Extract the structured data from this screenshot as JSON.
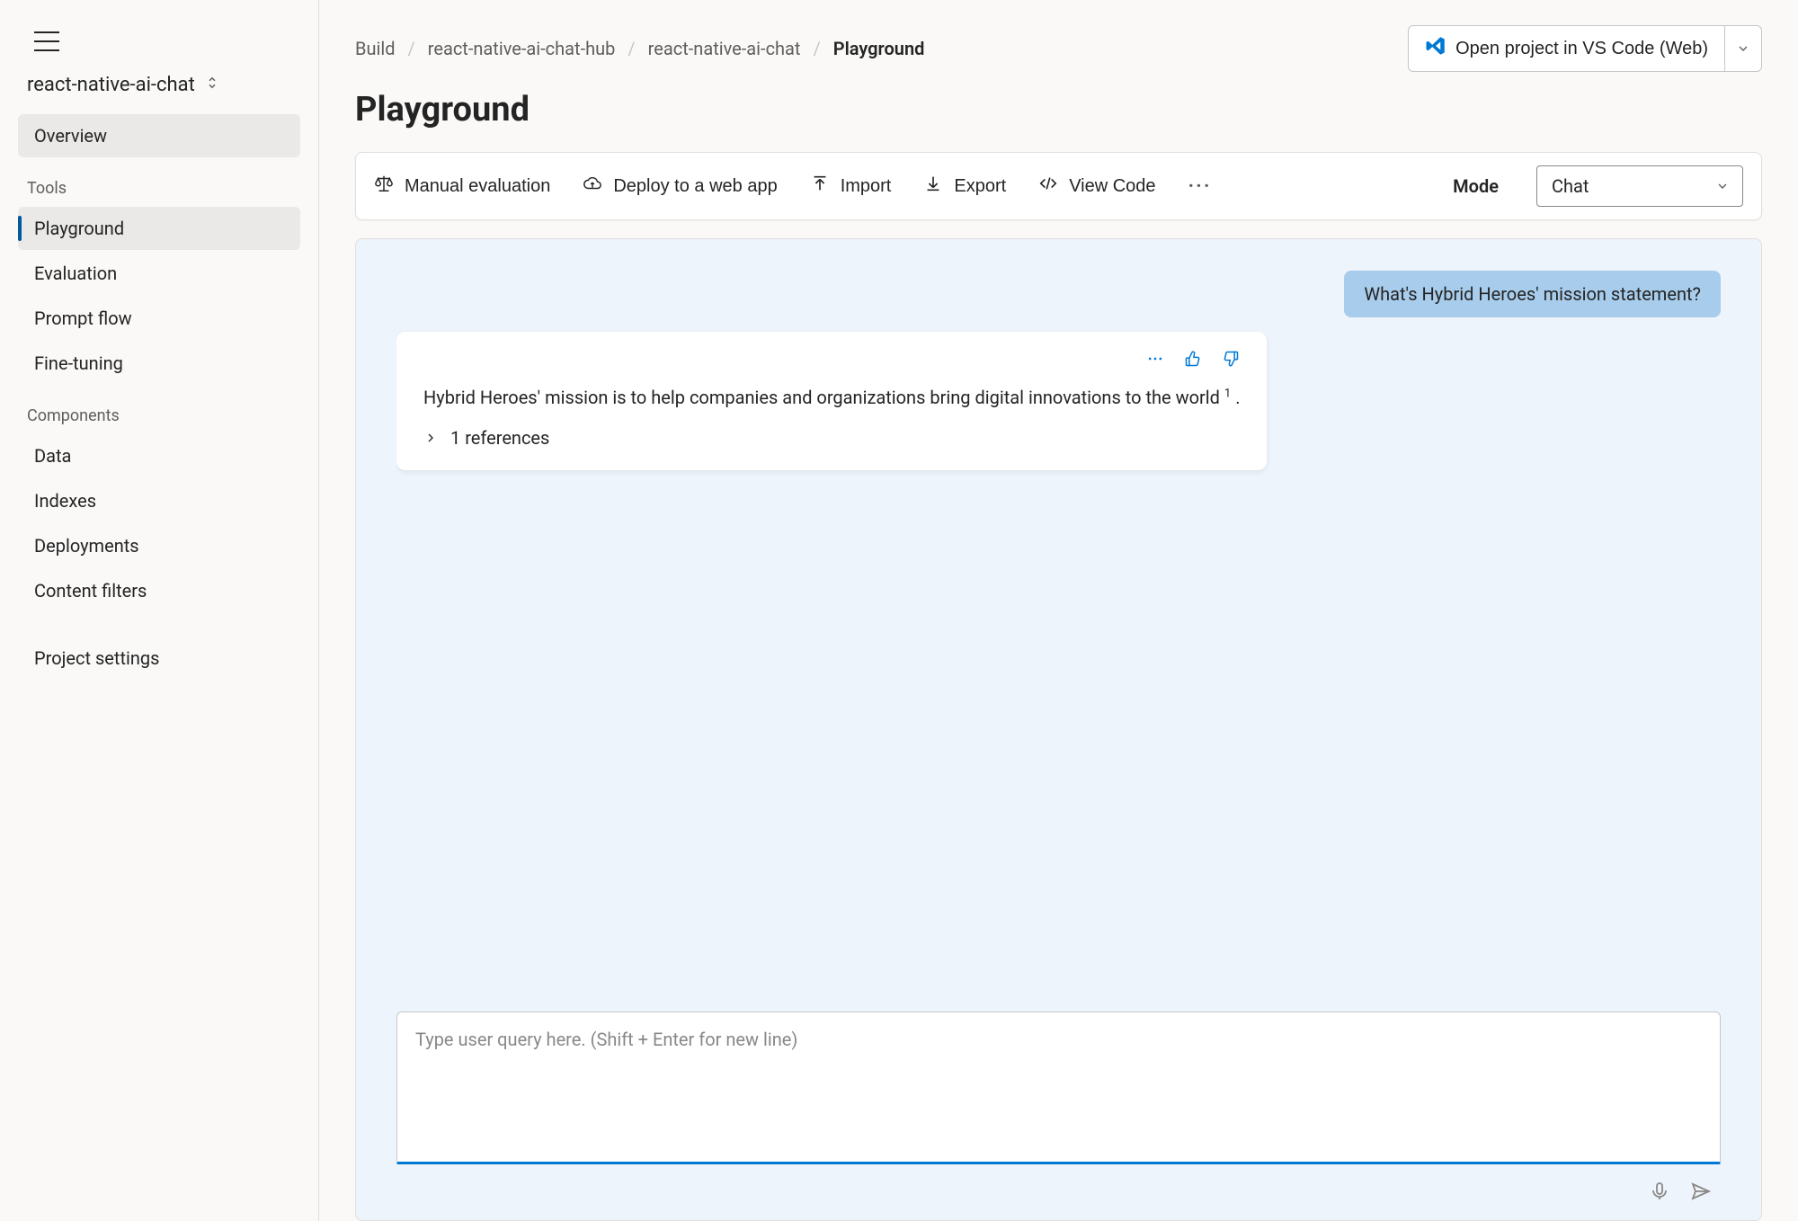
{
  "sidebar": {
    "project_name": "react-native-ai-chat",
    "overview_label": "Overview",
    "sections": {
      "tools_label": "Tools",
      "components_label": "Components"
    },
    "tools": [
      {
        "label": "Playground",
        "active": true
      },
      {
        "label": "Evaluation",
        "active": false
      },
      {
        "label": "Prompt flow",
        "active": false
      },
      {
        "label": "Fine-tuning",
        "active": false
      }
    ],
    "components": [
      {
        "label": "Data"
      },
      {
        "label": "Indexes"
      },
      {
        "label": "Deployments"
      },
      {
        "label": "Content filters"
      }
    ],
    "project_settings_label": "Project settings"
  },
  "breadcrumb": {
    "items": [
      "Build",
      "react-native-ai-chat-hub",
      "react-native-ai-chat"
    ],
    "current": "Playground"
  },
  "header": {
    "open_vscode_label": "Open project in VS Code (Web)"
  },
  "page": {
    "title": "Playground"
  },
  "toolbar": {
    "manual_eval": "Manual evaluation",
    "deploy": "Deploy to a web app",
    "import": "Import",
    "export": "Export",
    "view_code": "View Code",
    "mode_label": "Mode",
    "mode_value": "Chat"
  },
  "chat": {
    "user_message": "What's Hybrid Heroes' mission statement?",
    "assistant_message": "Hybrid Heroes' mission is to help companies and organizations bring digital innovations to the world",
    "citation_marker": "1",
    "period": " .",
    "references_label": "1 references",
    "input_placeholder": "Type user query here. (Shift + Enter for new line)"
  }
}
